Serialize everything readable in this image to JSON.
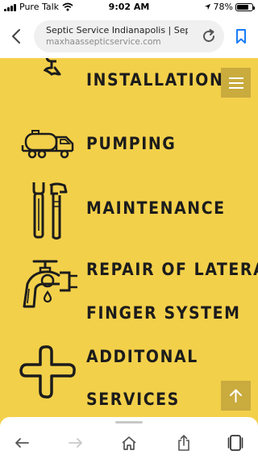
{
  "status_bar": {
    "carrier": "Pure Talk",
    "time": "9:02 AM",
    "battery": "78%",
    "battery_level": 0.78
  },
  "browser": {
    "page_title": "Septic Service Indianapolis | Septic",
    "url": "maxhaassepticservice.com",
    "icons": [
      "back-icon",
      "reload-icon",
      "bookmark-icon"
    ]
  },
  "services": [
    {
      "label": "INSTALLATION",
      "icon": "wrench-icon"
    },
    {
      "label": "PUMPING",
      "icon": "tanker-truck-icon"
    },
    {
      "label": "MAINTENANCE",
      "icon": "tools-icon"
    },
    {
      "label_line1": "REPAIR OF LATERAL",
      "label_line2": "FINGER SYSTEM",
      "icon": "faucet-icon"
    },
    {
      "label_line1": "ADDITONAL",
      "label_line2": "SERVICES",
      "icon": "plus-icon"
    }
  ],
  "page_buttons": [
    "hamburger-menu-icon",
    "scroll-to-top-icon"
  ],
  "toolbar": [
    "back-arrow-icon",
    "forward-arrow-icon",
    "home-icon",
    "share-icon",
    "tabs-icon"
  ],
  "colors": {
    "page_bg": "#f3d04a",
    "button_bg": "#c9ab3e",
    "text": "#1c1c1c",
    "link_blue": "#1a7cf5"
  }
}
